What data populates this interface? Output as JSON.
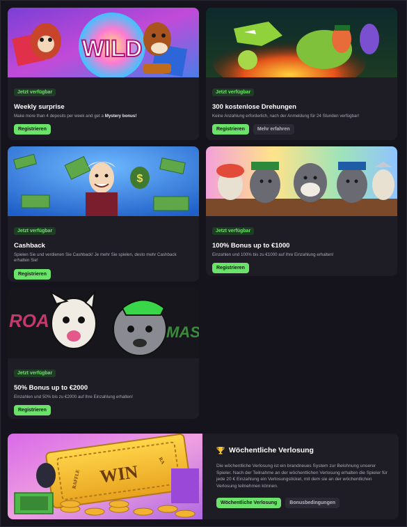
{
  "promos": [
    {
      "badge": "Jetzt verfügbar",
      "title": "Weekly surprise",
      "desc_prefix": "Make more than 4 deposits per week and get a ",
      "desc_bold": "Mystery bonus!",
      "primary_label": "Registrieren",
      "art_label": "WILD"
    },
    {
      "badge": "Jetzt verfügbar",
      "title": "300 kostenlose Drehungen",
      "desc": "Keine Anzahlung erforderlich, nach der Anmeldung für 24 Stunden verfügbar!",
      "primary_label": "Registrieren",
      "secondary_label": "Mehr erfahren"
    },
    {
      "badge": "Jetzt verfügbar",
      "title": "Cashback",
      "desc": "Spielen Sie und verdienen Sie Cashback! Je mehr Sie spielen, desto mehr Cashback erhalten Sie!",
      "primary_label": "Registrieren",
      "art_label": "$"
    },
    {
      "badge": "Jetzt verfügbar",
      "title": "100% Bonus up to €1000",
      "desc": "Einzahlen und 100% bis zu €1000 auf Ihre Einzahlung erhalten!",
      "primary_label": "Registrieren"
    },
    {
      "badge": "Jetzt verfügbar",
      "title": "50% Bonus up to €2000",
      "desc": "Einzahlen und 50% bis zu €2000 auf Ihre Einzahlung erhalten!",
      "primary_label": "Registrieren",
      "art_left": "ROA",
      "art_right": "MAS"
    }
  ],
  "raffle": {
    "title": "Wöchentliche Verlosung",
    "desc": "Die wöchentliche Verlosung ist ein brandneues System zur Belohnung unserer Spieler. Nach der Teilnahme an der wöchentlichen Verlosung erhalten die Spieler für jede 20 € Einzahlung ein Verlosungsticket, mit dem sie an der wöchentlichen Verlosung teilnehmen können.",
    "primary_label": "Wöchentliche Verlosung",
    "secondary_label": "Bonusbedingungen",
    "ticket_word": "WIN",
    "ticket_small_left": "RAFFLE",
    "ticket_small_right": "RA"
  },
  "colors": {
    "accent": "#6be36a",
    "background": "#15141c",
    "card": "#1e1d25"
  }
}
